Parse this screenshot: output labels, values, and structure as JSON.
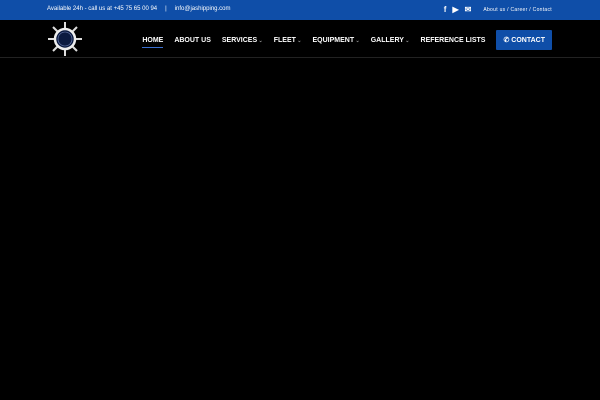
{
  "topbar": {
    "availability": "Available 24h - call us at +45 75 65 00 94",
    "separator": "|",
    "email": "info@jashipping.com",
    "icons": [
      "facebook-icon",
      "youtube-icon",
      "mail-icon"
    ],
    "links": "About us / Career / Contact"
  },
  "nav": {
    "items": [
      {
        "label": "HOME",
        "dropdown": false
      },
      {
        "label": "ABOUT US",
        "dropdown": false
      },
      {
        "label": "SERVICES",
        "dropdown": true
      },
      {
        "label": "FLEET",
        "dropdown": true
      },
      {
        "label": "EQUIPMENT",
        "dropdown": true
      },
      {
        "label": "GALLERY",
        "dropdown": true
      },
      {
        "label": "REFERENCE LISTS",
        "dropdown": false
      }
    ],
    "contact": "CONTACT",
    "phone_icon": "✆"
  },
  "colors": {
    "brand": "#0f4ea8"
  }
}
